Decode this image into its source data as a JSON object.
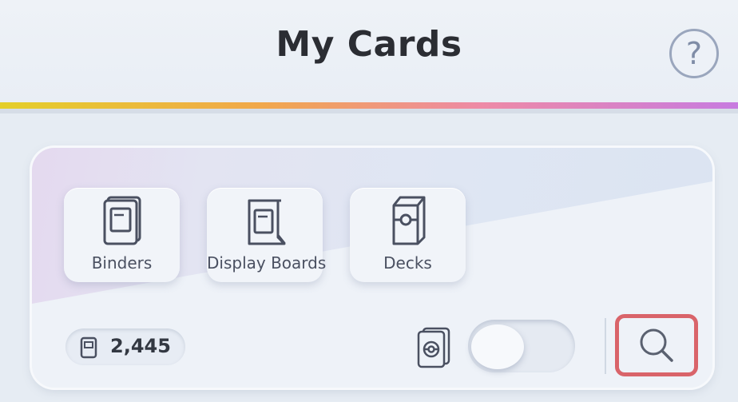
{
  "header": {
    "title": "My Cards",
    "help_icon": "question-circle-icon",
    "help_symbol": "?"
  },
  "collection": {
    "tiles": [
      {
        "label": "Binders",
        "icon": "binder-icon"
      },
      {
        "label": "Display Boards",
        "icon": "display-board-icon"
      },
      {
        "label": "Decks",
        "icon": "deck-box-icon"
      }
    ],
    "card_count": "2,445",
    "card_count_icon": "card-icon",
    "toggle_icon": "deck-cards-icon",
    "toggle_on": false,
    "search_icon": "search-icon"
  },
  "colors": {
    "title": "#2b2d33",
    "accent_gradient": [
      "#e4cf2a",
      "#f1a84a",
      "#ee8aa6",
      "#c77be0"
    ],
    "highlight_border": "#d9646a"
  }
}
